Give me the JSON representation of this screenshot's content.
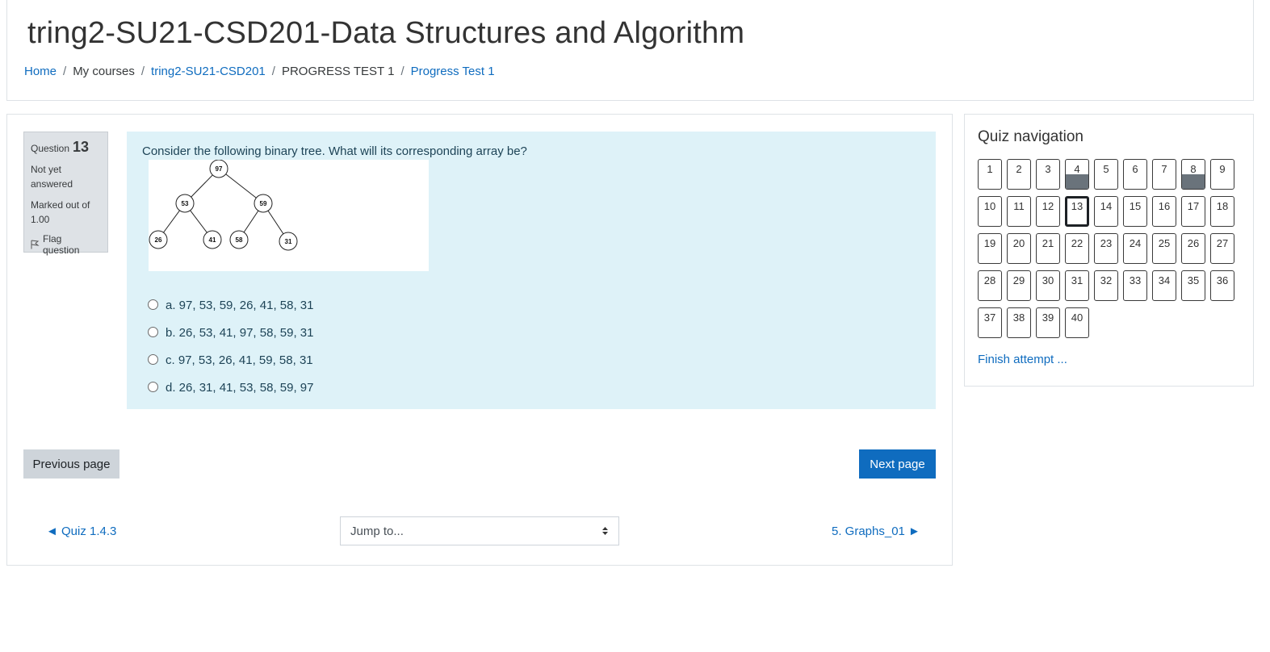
{
  "header": {
    "title": "tring2-SU21-CSD201-Data Structures and Algorithm",
    "breadcrumb": [
      {
        "label": "Home",
        "link": true
      },
      {
        "label": "My courses",
        "link": false
      },
      {
        "label": "tring2-SU21-CSD201",
        "link": true
      },
      {
        "label": "PROGRESS TEST 1",
        "link": false
      },
      {
        "label": "Progress Test 1",
        "link": true
      }
    ]
  },
  "question_info": {
    "label": "Question",
    "number": "13",
    "state": "Not yet answered",
    "grade": "Marked out of 1.00",
    "flag_label": "Flag question"
  },
  "question": {
    "text": "Consider the following binary tree. What will its corresponding array be?",
    "tree_nodes": [
      "97",
      "53",
      "59",
      "26",
      "41",
      "58",
      "31"
    ],
    "answers": [
      "a. 97, 53, 59, 26, 41, 58, 31",
      "b. 26, 53, 41, 97, 58, 59, 31",
      "c. 97, 53, 26, 41, 59, 58, 31",
      "d. 26, 31, 41, 53, 58, 59, 97"
    ]
  },
  "buttons": {
    "previous_page": "Previous page",
    "next_page": "Next page"
  },
  "activity_nav": {
    "prev": "◄ Quiz 1.4.3",
    "jump_placeholder": "Jump to...",
    "next": "5. Graphs_01 ►"
  },
  "quiz_nav": {
    "title": "Quiz navigation",
    "questions": [
      "1",
      "2",
      "3",
      "4",
      "5",
      "6",
      "7",
      "8",
      "9",
      "10",
      "11",
      "12",
      "13",
      "14",
      "15",
      "16",
      "17",
      "18",
      "19",
      "20",
      "21",
      "22",
      "23",
      "24",
      "25",
      "26",
      "27",
      "28",
      "29",
      "30",
      "31",
      "32",
      "33",
      "34",
      "35",
      "36",
      "37",
      "38",
      "39",
      "40"
    ],
    "flagged": [
      "4",
      "8"
    ],
    "current": "13",
    "finish_label": "Finish attempt ..."
  },
  "colors": {
    "link": "#0f6cbf",
    "question_bg": "#def2f8",
    "info_bg": "#dee2e6",
    "primary_button": "#0f6cbf"
  }
}
